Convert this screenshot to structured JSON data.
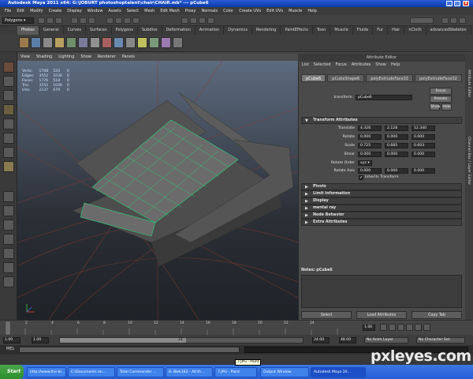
{
  "window": {
    "title": "Autodesk Maya 2011 x64: G:\\JOBURT photoshoptalent\\chair\\CHAIR.mb* --- pCube6"
  },
  "menubar": {
    "items": [
      "File",
      "Edit",
      "Modify",
      "Create",
      "Display",
      "Window",
      "Assets",
      "Select",
      "Mesh",
      "Edit Mesh",
      "Proxy",
      "Normals",
      "Color",
      "Create UVs",
      "Edit UVs",
      "Muscle",
      "Help"
    ]
  },
  "statusline": {
    "mode": "Polygons"
  },
  "shelf": {
    "tabs": [
      "Photos",
      "General",
      "Curves",
      "Surfaces",
      "Polygons",
      "Subdivs",
      "Deformation",
      "Animation",
      "Dynamics",
      "Rendering",
      "PaintEffects",
      "Toon",
      "Muscle",
      "Fluids",
      "Fur",
      "Hair",
      "nCloth",
      "advancedSkeleton"
    ]
  },
  "viewport": {
    "menu": [
      "View",
      "Shading",
      "Lighting",
      "Show",
      "Renderer",
      "Panels"
    ],
    "hud": [
      {
        "label": "Verts:",
        "a": "1708",
        "b": "520",
        "c": "0"
      },
      {
        "label": "Edges:",
        "a": "3552",
        "b": "1036",
        "c": "0"
      },
      {
        "label": "Faces:",
        "a": "1776",
        "b": "518",
        "c": "0"
      },
      {
        "label": "Tris:",
        "a": "3552",
        "b": "1036",
        "c": "0"
      },
      {
        "label": "UVs:",
        "a": "2137",
        "b": "679",
        "c": "0"
      }
    ]
  },
  "attribute_editor": {
    "title": "Attribute Editor",
    "menu": [
      "List",
      "Selected",
      "Focus",
      "Attributes",
      "Show",
      "Help"
    ],
    "tabs": [
      "pCube6",
      "pCubeShape6",
      "polyExtrudeFace33",
      "polyExtrudeFace32"
    ],
    "transform_label": "transform:",
    "transform_value": "pCube6",
    "focus_label": "Focus",
    "presets_label": "Presets",
    "show_label": "Show",
    "hide_label": "Hide",
    "section_transform": "Transform Attributes",
    "rows": [
      {
        "label": "Translate",
        "x": "4.326",
        "y": "2.128",
        "z": "12.340"
      },
      {
        "label": "Rotate",
        "x": "0.000",
        "y": "0.000",
        "z": "0.000"
      },
      {
        "label": "Scale",
        "x": "0.725",
        "y": "0.685",
        "z": "0.603"
      },
      {
        "label": "Shear",
        "x": "0.000",
        "y": "0.000",
        "z": "0.000"
      }
    ],
    "rotate_order_label": "Rotate Order",
    "rotate_order_value": "xyz",
    "rotate_axis_label": "Rotate Axis",
    "rotate_axis": {
      "x": "0.000",
      "y": "0.000",
      "z": "0.000"
    },
    "inherits_label": "Inherits Transform",
    "sections": [
      "Pivots",
      "Limit Information",
      "Display",
      "mental ray",
      "Node Behavior",
      "Extra Attributes"
    ],
    "notes_label": "Notes: pCube6",
    "buttons": [
      "Select",
      "Load Attributes",
      "Copy Tab"
    ]
  },
  "side_tabs": [
    "Attribute Editor",
    "Channel Box / Layer Editor"
  ],
  "timeslider": {
    "ticks": [
      "2",
      "4",
      "6",
      "8",
      "10",
      "12",
      "14",
      "16",
      "18",
      "20",
      "22",
      "24"
    ],
    "current": "1.00"
  },
  "range": {
    "start": "1.00",
    "start2": "1.00",
    "slider_value": "24",
    "end": "24.00",
    "end2": "48.00",
    "anim_layer": "No Anim Layer",
    "char_set": "No Character Set"
  },
  "mel_label": "MEL",
  "taskbar": {
    "start": "Start",
    "tasks": [
      "http://www.the-bl...",
      "C:\\Documents an...",
      "Total Commander ...",
      "8. Blek162 - All th...",
      "7.JPG - Paint",
      "Output Window",
      "Autodesk Maya 20..."
    ],
    "tooltip": "7.JPG - Paint"
  },
  "watermark": "pxleyes.com"
}
